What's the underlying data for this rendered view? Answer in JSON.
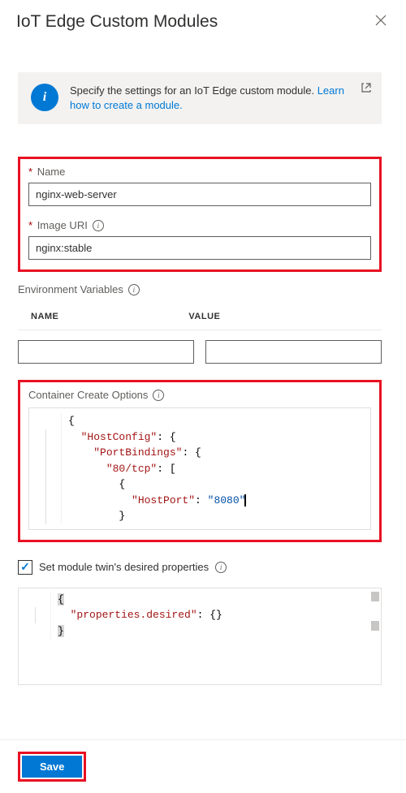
{
  "header": {
    "title": "IoT Edge Custom Modules"
  },
  "banner": {
    "text": "Specify the settings for an IoT Edge custom module. ",
    "link": "Learn how to create a module."
  },
  "fields": {
    "name_label": "Name",
    "name_value": "nginx-web-server",
    "image_label": "Image URI",
    "image_value": "nginx:stable"
  },
  "env": {
    "section_label": "Environment Variables",
    "name_header": "NAME",
    "value_header": "VALUE",
    "name_value": "",
    "value_value": ""
  },
  "cco": {
    "section_label": "Container Create Options",
    "k_hostconfig": "\"HostConfig\"",
    "k_portbindings": "\"PortBindings\"",
    "k_80tcp": "\"80/tcp\"",
    "k_hostport": "\"HostPort\"",
    "v_8080": "\"8080\""
  },
  "twin": {
    "checkbox_label": "Set module twin's desired properties",
    "k_propdesired": "\"properties.desired\""
  },
  "footer": {
    "save_label": "Save"
  }
}
